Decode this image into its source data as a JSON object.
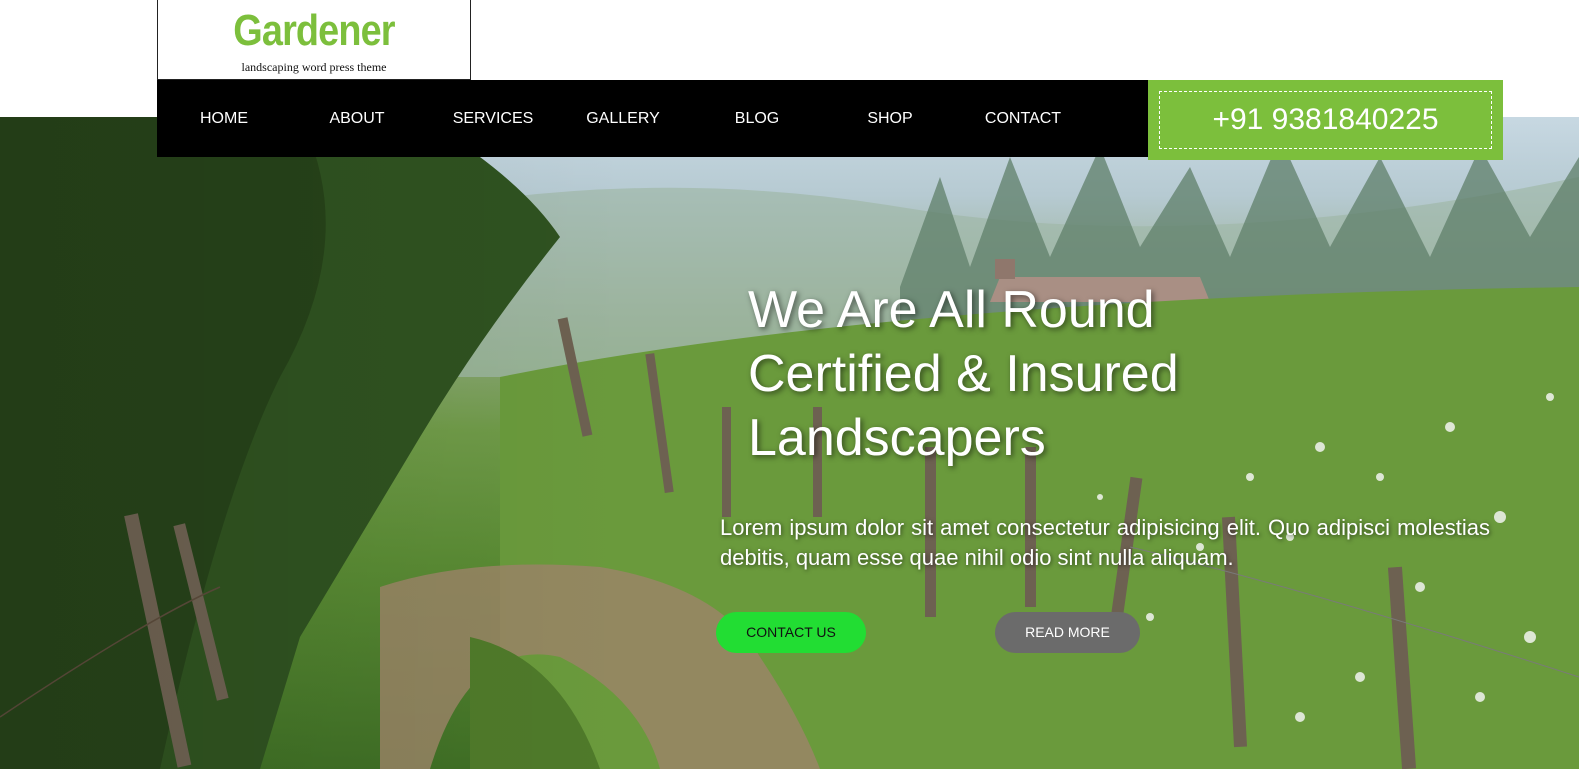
{
  "logo": {
    "title": "Gardener",
    "tagline": "landscaping word press theme"
  },
  "nav": {
    "items": [
      "HOME",
      "ABOUT",
      "SERVICES",
      "GALLERY",
      "BLOG",
      "SHOP",
      "CONTACT"
    ]
  },
  "phone": "+91 9381840225",
  "hero": {
    "headline": "We Are All Round Certified & Insured Landscapers",
    "subtext": "Lorem ipsum dolor sit amet consectetur adipisicing elit. Quo adipisci molestias debitis, quam esse quae nihil odio sint nulla aliquam.",
    "contact_button": "CONTACT US",
    "read_more_button": "READ MORE"
  },
  "colors": {
    "brand_green": "#7cbf3c",
    "nav_background": "#000000",
    "contact_button": "#22dd33",
    "read_more_button": "#6b6b6b"
  }
}
